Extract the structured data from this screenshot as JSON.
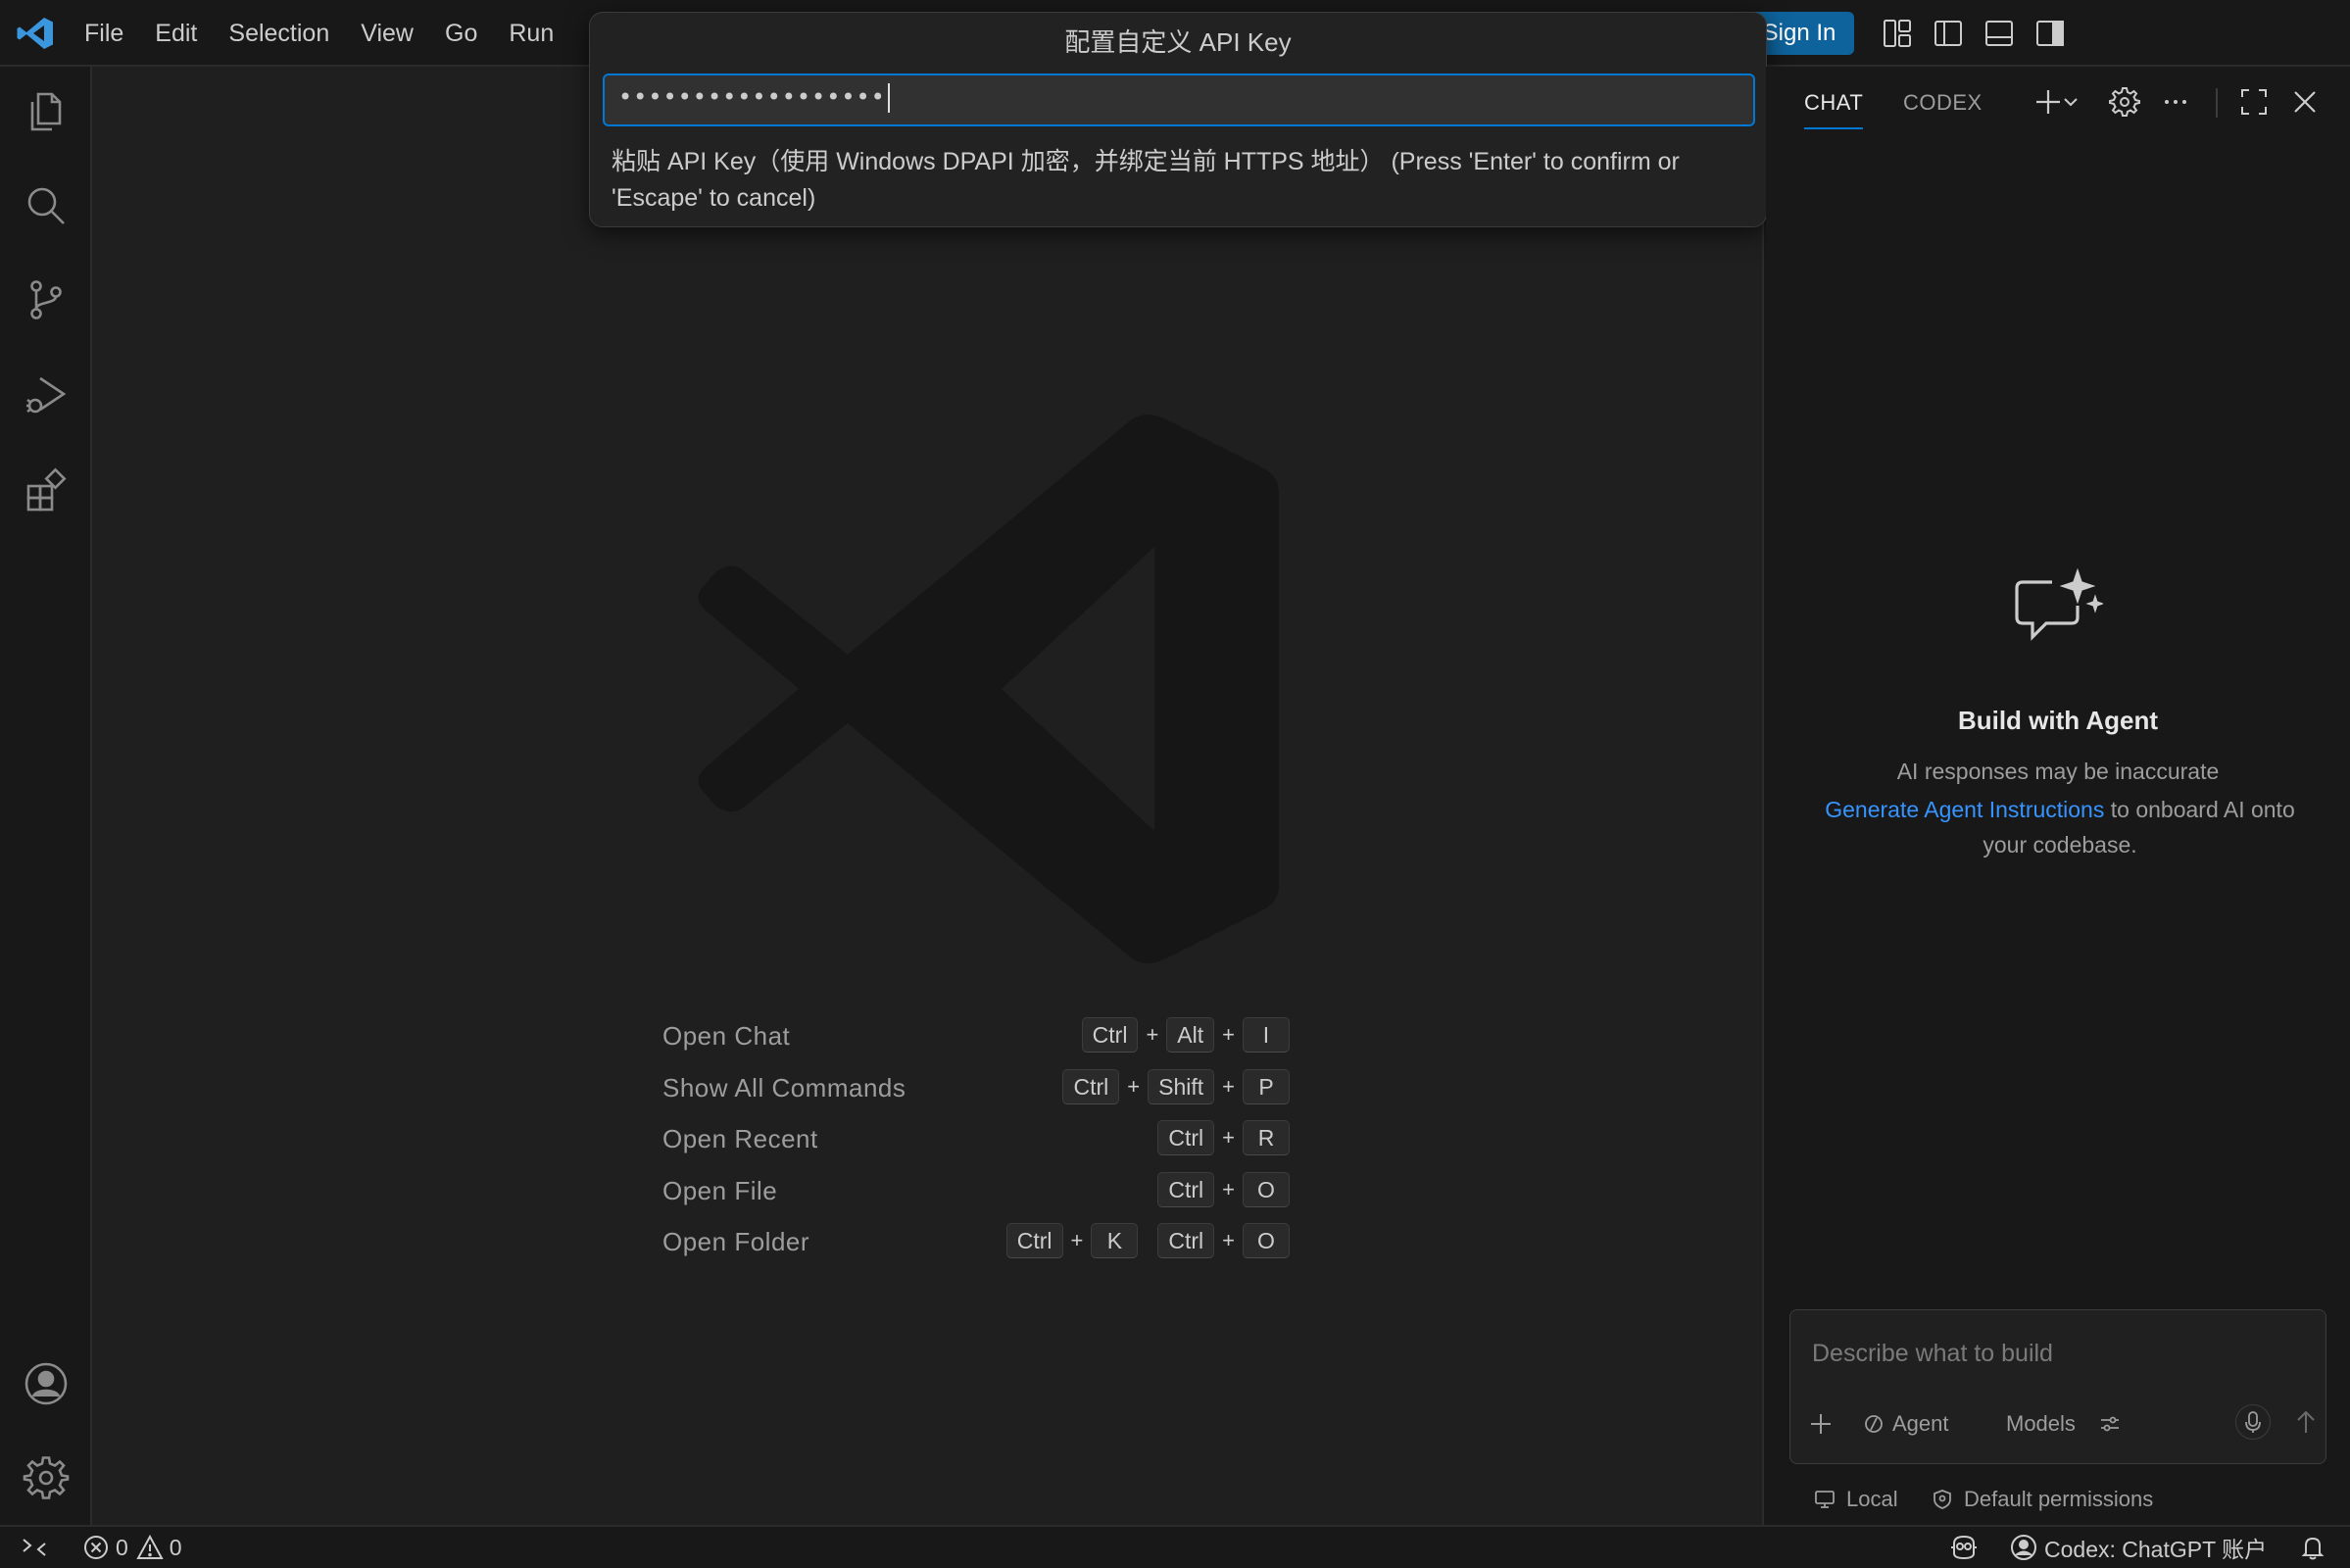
{
  "menu": {
    "items": [
      "File",
      "Edit",
      "Selection",
      "View",
      "Go",
      "Run"
    ]
  },
  "titlebar": {
    "sign_in_label": "Sign In"
  },
  "quick_input": {
    "title": "配置自定义 API Key",
    "value": "••••••••••••••••••",
    "message": "粘贴 API Key（使用 Windows DPAPI 加密，并绑定当前 HTTPS 地址） (Press 'Enter' to confirm or 'Escape' to cancel)"
  },
  "activity_bar": {
    "icons": [
      "files-icon",
      "search-icon",
      "source-control-icon",
      "run-debug-icon",
      "extensions-icon",
      "account-icon",
      "manage-gear-icon"
    ]
  },
  "shortcuts": [
    {
      "label": "Open Chat",
      "keys": [
        [
          "Ctrl",
          "Alt",
          "I"
        ]
      ]
    },
    {
      "label": "Show All Commands",
      "keys": [
        [
          "Ctrl",
          "Shift",
          "P"
        ]
      ]
    },
    {
      "label": "Open Recent",
      "keys": [
        [
          "Ctrl",
          "R"
        ]
      ]
    },
    {
      "label": "Open File",
      "keys": [
        [
          "Ctrl",
          "O"
        ]
      ]
    },
    {
      "label": "Open Folder",
      "keys": [
        [
          "Ctrl",
          "K"
        ],
        [
          "Ctrl",
          "O"
        ]
      ]
    }
  ],
  "chat": {
    "tabs": [
      "CHAT",
      "CODEX"
    ],
    "active_tab": "CHAT",
    "title": "Build with Agent",
    "subtitle": "AI responses may be inaccurate",
    "link_text": "Generate Agent Instructions",
    "instruction_rest": " to onboard AI onto your codebase.",
    "input_placeholder": "Describe what to build",
    "mode_label": "Agent",
    "models_label": "Models",
    "footer_local": "Local",
    "footer_permissions": "Default permissions"
  },
  "status_bar": {
    "errors": "0",
    "warnings": "0",
    "account_label": "Codex: ChatGPT 账户"
  },
  "colors": {
    "accent": "#0078d4",
    "sign_in_bg": "#0e639c",
    "link": "#3794ff",
    "vscode_blue": "#3a96dd"
  }
}
